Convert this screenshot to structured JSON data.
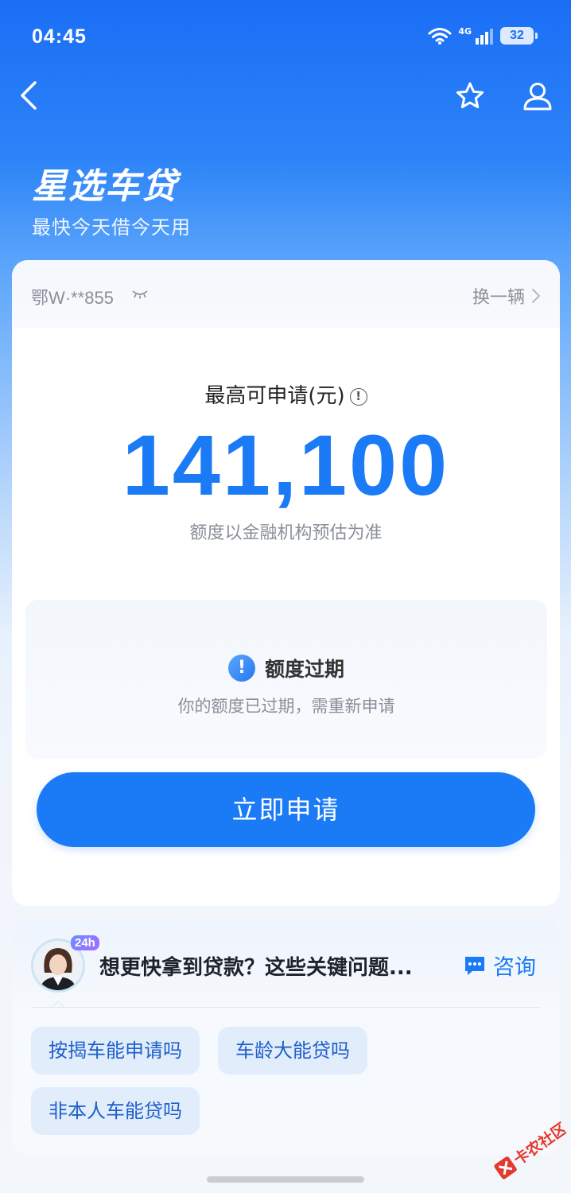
{
  "status_bar": {
    "time": "04:45",
    "network": "4G",
    "battery": "32"
  },
  "header": {
    "title": "星选车贷",
    "subtitle": "最快今天借今天用"
  },
  "vehicle": {
    "plate": "鄂W·**855",
    "switch_label": "换一辆"
  },
  "limit": {
    "label": "最高可申请(元)",
    "amount": "141,100",
    "note": "额度以金融机构预估为准"
  },
  "expired": {
    "title": "额度过期",
    "description": "你的额度已过期，需重新申请"
  },
  "apply_button": "立即申请",
  "qa": {
    "badge": "24h",
    "question": "想更快拿到贷款？这些关键问题...",
    "consult_label": "咨询",
    "chips": [
      "按揭车能申请吗",
      "车龄大能贷吗",
      "非本人车能贷吗"
    ]
  },
  "watermark": "卡农社区",
  "colors": {
    "brand_blue": "#1b7af5",
    "header_gradient_top": "#1a6ef5"
  }
}
